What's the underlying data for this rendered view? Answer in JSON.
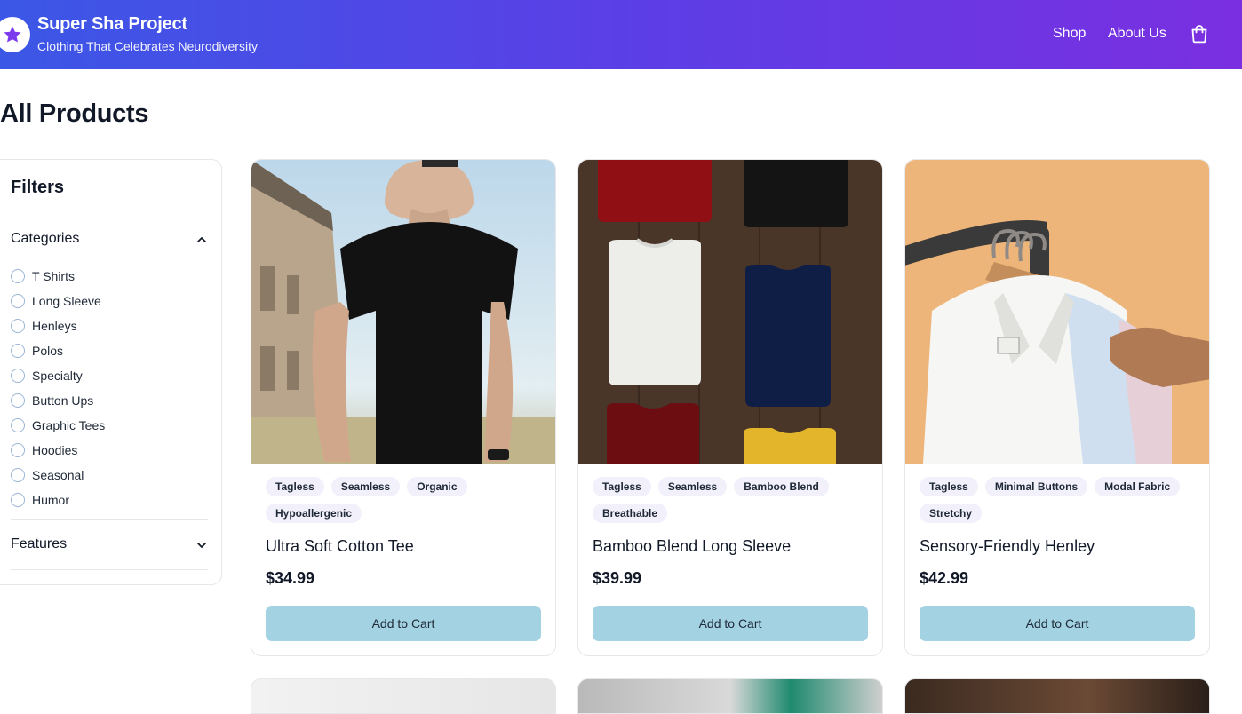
{
  "header": {
    "brand_title": "Super Sha Project",
    "brand_subtitle": "Clothing That Celebrates Neurodiversity",
    "nav": {
      "shop": "Shop",
      "about": "About Us"
    },
    "logo_icon": "star-icon",
    "cart_icon": "shopping-bag-icon",
    "gradient_start": "#3b57e6",
    "gradient_end": "#7a2fe0"
  },
  "page_title": "All Products",
  "filters": {
    "title": "Filters",
    "categories_label": "Categories",
    "categories": [
      "T Shirts",
      "Long Sleeve",
      "Henleys",
      "Polos",
      "Specialty",
      "Button Ups",
      "Graphic Tees",
      "Hoodies",
      "Seasonal",
      "Humor"
    ],
    "features_label": "Features"
  },
  "products": [
    {
      "tags": [
        "Tagless",
        "Seamless",
        "Organic",
        "Hypoallergenic"
      ],
      "name": "Ultra Soft Cotton Tee",
      "price": "$34.99",
      "button": "Add to Cart"
    },
    {
      "tags": [
        "Tagless",
        "Seamless",
        "Bamboo Blend",
        "Breathable"
      ],
      "name": "Bamboo Blend Long Sleeve",
      "price": "$39.99",
      "button": "Add to Cart"
    },
    {
      "tags": [
        "Tagless",
        "Minimal Buttons",
        "Modal Fabric",
        "Stretchy"
      ],
      "name": "Sensory-Friendly Henley",
      "price": "$42.99",
      "button": "Add to Cart"
    }
  ],
  "colors": {
    "button_bg": "#a3d3e3",
    "tag_bg": "#f1f0fb",
    "accent": "#7c3aed"
  }
}
